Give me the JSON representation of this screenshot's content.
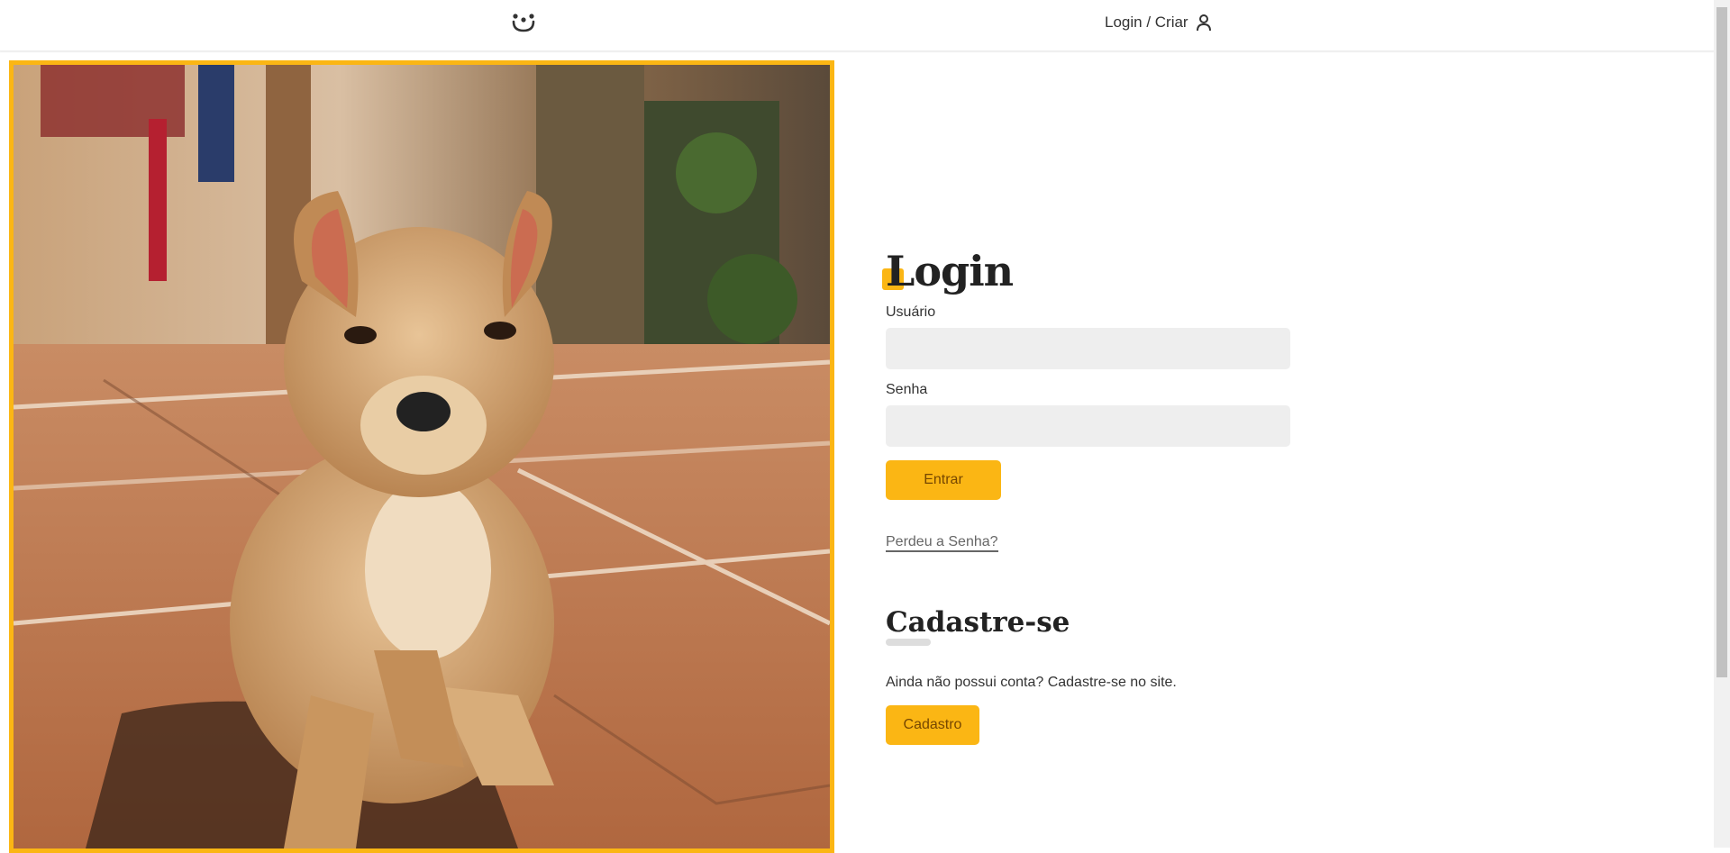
{
  "header": {
    "logo_icon": "dog-face-icon",
    "login_link": "Login / Criar",
    "user_icon": "user-icon"
  },
  "photo": {
    "description_icon": "puppy-photo",
    "frame_color": "#fbb614"
  },
  "login": {
    "title": "Login",
    "username_label": "Usuário",
    "username_value": "",
    "password_label": "Senha",
    "password_value": "",
    "submit_label": "Entrar",
    "lost_password_link": "Perdeu a Senha?"
  },
  "register": {
    "title": "Cadastre-se",
    "text": "Ainda não possui conta? Cadastre-se no site.",
    "button_label": "Cadastro"
  },
  "colors": {
    "accent": "#fbb614",
    "button_text": "#764701",
    "input_bg": "#eeeeee"
  }
}
